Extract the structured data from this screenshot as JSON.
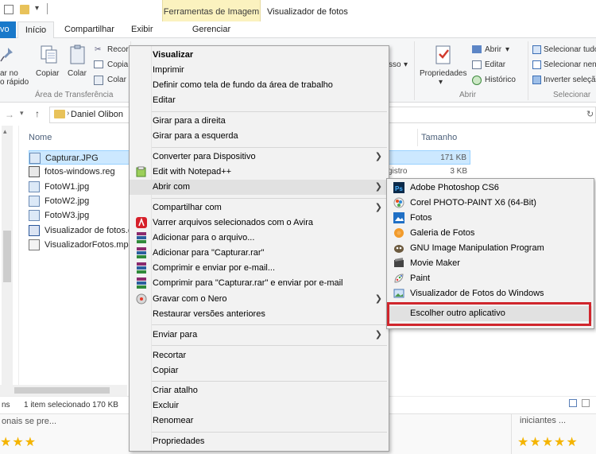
{
  "titlebar": {
    "contextual_tab_label": "Ferramentas de Imagem",
    "title": "Visualizador de fotos"
  },
  "tabs": {
    "file": "vo",
    "home": "Início",
    "share": "Compartilhar",
    "view": "Exibir",
    "manage": "Gerenciar"
  },
  "ribbon": {
    "pin": [
      "ar no",
      "o rápido"
    ],
    "copy": "Copiar",
    "paste": "Colar",
    "cut": "Recor",
    "copy_path": "Copia",
    "paste_shortcut": "Colar",
    "clipboard_group": "Área de Transferência",
    "move_sso": "sso",
    "properties": "Propriedades",
    "open": "Abrir",
    "edit": "Editar",
    "history": "Histórico",
    "open_group": "Abrir",
    "select_all": "Selecionar tudo",
    "select_none": "Selecionar nenh",
    "invert_selection": "Inverter seleçã",
    "select_group": "Selecionar"
  },
  "address": {
    "path": "Daniel Olibon"
  },
  "list": {
    "header_name": "Nome",
    "header_size": "Tamanho",
    "files": [
      {
        "name": "Capturar.JPG",
        "size": "171 KB",
        "type": ""
      },
      {
        "name": "fotos-windows.reg",
        "size": "3 KB",
        "type": "gistro"
      },
      {
        "name": "FotoW1.jpg",
        "size": "",
        "type": ""
      },
      {
        "name": "FotoW2.jpg",
        "size": "",
        "type": ""
      },
      {
        "name": "FotoW3.jpg",
        "size": "",
        "type": ""
      },
      {
        "name": "Visualizador de fotos.d",
        "size": "",
        "type": ""
      },
      {
        "name": "VisualizadorFotos.mp4",
        "size": "",
        "type": ""
      }
    ]
  },
  "status": {
    "left": "ns",
    "selection": "1 item selecionado  170 KB"
  },
  "web": {
    "snippet_left": "onais se pre...",
    "snippet_right": "iniciantes ...",
    "stars_left": "★★★",
    "stars_right": "★★★★★"
  },
  "context_menu": {
    "items": [
      {
        "label": "Visualizar"
      },
      {
        "label": "Imprimir"
      },
      {
        "label": "Definir como tela de fundo da área de trabalho"
      },
      {
        "label": "Editar"
      },
      {
        "label": "Girar para a direita"
      },
      {
        "label": "Girar para a esquerda"
      },
      {
        "label": "Converter para Dispositivo"
      },
      {
        "label": "Edit with Notepad++"
      },
      {
        "label": "Abrir com"
      },
      {
        "label": "Compartilhar com"
      },
      {
        "label": "Varrer arquivos selecionados com o Avira"
      },
      {
        "label": "Adicionar para o arquivo..."
      },
      {
        "label": "Adicionar para \"Capturar.rar\""
      },
      {
        "label": "Comprimir e enviar por e-mail..."
      },
      {
        "label": "Comprimir para \"Capturar.rar\" e enviar por e-mail"
      },
      {
        "label": "Gravar com o Nero"
      },
      {
        "label": "Restaurar versões anteriores"
      },
      {
        "label": "Enviar para"
      },
      {
        "label": "Recortar"
      },
      {
        "label": "Copiar"
      },
      {
        "label": "Criar atalho"
      },
      {
        "label": "Excluir"
      },
      {
        "label": "Renomear"
      },
      {
        "label": "Propriedades"
      }
    ]
  },
  "open_with_menu": {
    "items": [
      {
        "label": "Adobe Photoshop CS6"
      },
      {
        "label": "Corel PHOTO-PAINT X6 (64-Bit)"
      },
      {
        "label": "Fotos"
      },
      {
        "label": "Galeria de Fotos"
      },
      {
        "label": "GNU Image Manipulation Program"
      },
      {
        "label": "Movie Maker"
      },
      {
        "label": "Paint"
      },
      {
        "label": "Visualizador de Fotos do Windows"
      },
      {
        "label": "Escolher outro aplicativo"
      }
    ]
  },
  "colors": {
    "highlight_box": "#d0262d",
    "file_tab": "#1979ca",
    "contextual_band": "#fbf2bf"
  }
}
